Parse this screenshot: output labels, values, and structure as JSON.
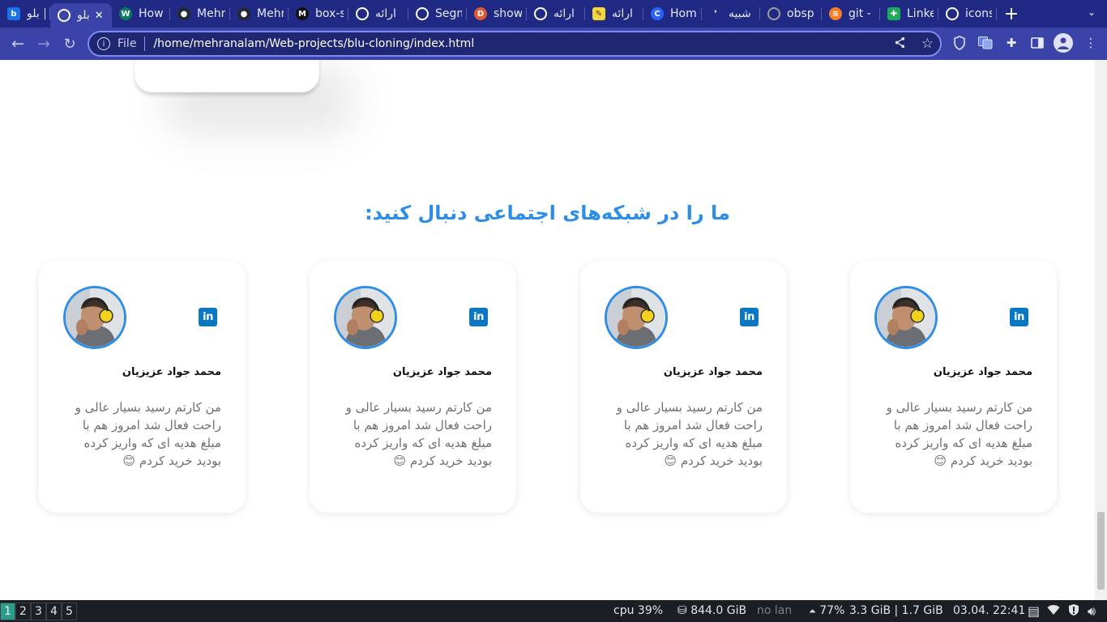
{
  "browser": {
    "tabs": [
      {
        "title": "بلو | ...",
        "icon": "letter-b-icon",
        "color": "#1a73e8"
      },
      {
        "title": "بلو",
        "icon": "globe-icon",
        "color": "#ffffff",
        "active": true
      },
      {
        "title": "How",
        "icon": "w-logo-icon",
        "color": "#0b7a5c"
      },
      {
        "title": "Mehr",
        "icon": "github-icon",
        "color": "#24292f"
      },
      {
        "title": "Mehr",
        "icon": "github-icon",
        "color": "#24292f"
      },
      {
        "title": "box-s",
        "icon": "m-logo-icon",
        "color": "#111111"
      },
      {
        "title": "ارائه",
        "icon": "globe-icon",
        "color": "#ffffff"
      },
      {
        "title": "Segm",
        "icon": "globe-icon",
        "color": "#ffffff"
      },
      {
        "title": "show",
        "icon": "duckduckgo-icon",
        "color": "#de5833"
      },
      {
        "title": "ارائه",
        "icon": "globe-icon",
        "color": "#ffffff"
      },
      {
        "title": "ارائه",
        "icon": "note-icon",
        "color": "#f4d53c"
      },
      {
        "title": "Hom",
        "icon": "c-logo-icon",
        "color": "#2962ff"
      },
      {
        "title": "شبیه",
        "icon": "quote-icon",
        "color": "#202a84"
      },
      {
        "title": "obsp",
        "icon": "globe-icon",
        "color": "#9e9e9e"
      },
      {
        "title": "git - I",
        "icon": "stackoverflow-icon",
        "color": "#f48024"
      },
      {
        "title": "Linke",
        "icon": "plus-square-icon",
        "color": "#1faa59"
      },
      {
        "title": "icons",
        "icon": "globe-icon",
        "color": "#ffffff"
      }
    ],
    "new_tab_label": "+",
    "tab_menu_label": "⌄",
    "close_tab_label": "✕",
    "address": {
      "scheme_label": "File",
      "url": "/home/mehranalam/Web-projects/blu-cloning/index.html"
    }
  },
  "page": {
    "section_title": "ما را در شبکه‌های اجتماعی دنبال کنید:",
    "cards": [
      {
        "name": "محمد جواد عزیزیان",
        "quote": "من کارتم رسید بسیار عالی و راحت فعال شد امروز هم با مبلغ هدیه ای که واریز کرده بودید خرید کردم 😊",
        "social": "in"
      },
      {
        "name": "محمد جواد عزیزیان",
        "quote": "من کارتم رسید بسیار عالی و راحت فعال شد امروز هم با مبلغ هدیه ای که واریز کرده بودید خرید کردم 😊",
        "social": "in"
      },
      {
        "name": "محمد جواد عزیزیان",
        "quote": "من کارتم رسید بسیار عالی و راحت فعال شد امروز هم با مبلغ هدیه ای که واریز کرده بودید خرید کردم 😊",
        "social": "in"
      },
      {
        "name": "محمد جواد عزیزیان",
        "quote": "من کارتم رسید بسیار عالی و راحت فعال شد امروز هم با مبلغ هدیه ای که واریز کرده بودید خرید کردم 😊",
        "social": "in"
      }
    ],
    "accent_color": "#2e8ee6"
  },
  "statusbar": {
    "workspaces": [
      "1",
      "2",
      "3",
      "4",
      "5"
    ],
    "active_workspace": "1",
    "cpu": "cpu  39%",
    "disk": "844.0 GiB",
    "lan": "no lan",
    "battery": "77%",
    "memory": "3.3 GiB | 1.7 GiB",
    "datetime": "03.04. 22:41"
  }
}
